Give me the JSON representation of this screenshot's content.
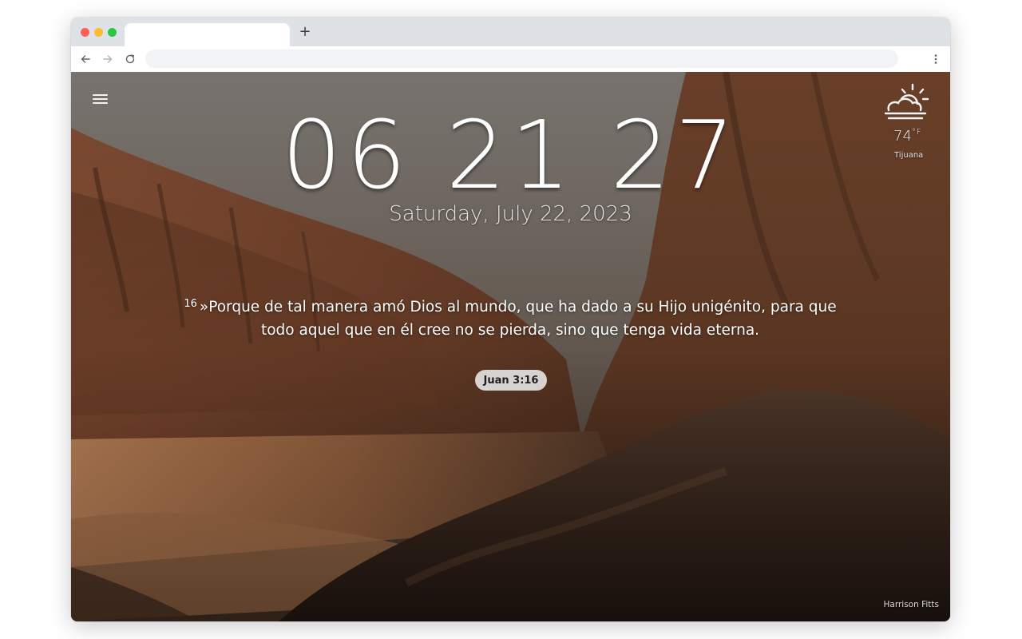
{
  "browser": {
    "tab_title": "",
    "new_tab_symbol": "+",
    "address": ""
  },
  "clock": {
    "time": "06 21 27",
    "date": "Saturday, July 22, 2023"
  },
  "weather": {
    "icon": "partly-cloudy-sun-icon",
    "temperature": "74",
    "unit": "°F",
    "city": "Tijuana"
  },
  "verse": {
    "number": "16",
    "text": "»Porque de tal manera amó Dios al mundo, que ha dado a su Hijo unigénito, para que todo aquel que en él cree no se pierda, sino que tenga vida eterna.",
    "reference": "Juan 3:16"
  },
  "photo_credit": "Harrison Fitts",
  "colors": {
    "tabstrip": "#dee1e6",
    "omnibox": "#f1f3f4",
    "reference_pill": "#e9e9e9"
  }
}
